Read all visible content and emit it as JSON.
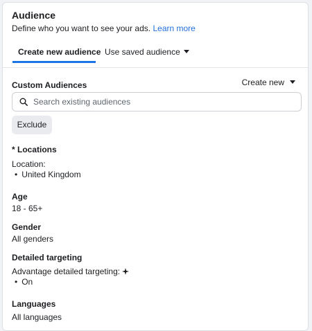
{
  "audience": {
    "title": "Audience",
    "subtitle": "Define who you want to see your ads.",
    "learn_more": "Learn more"
  },
  "tabs": [
    {
      "label": "Create new audience",
      "active": true
    },
    {
      "label": "Use saved audience",
      "active": false
    }
  ],
  "custom_audiences": {
    "label": "Custom Audiences",
    "create_new": "Create new",
    "search_placeholder": "Search existing audiences",
    "exclude_label": "Exclude"
  },
  "locations": {
    "label": "* Locations",
    "sublabel": "Location:",
    "items": [
      "United Kingdom"
    ]
  },
  "age": {
    "label": "Age",
    "value": "18 - 65+"
  },
  "gender": {
    "label": "Gender",
    "value": "All genders"
  },
  "detailed_targeting": {
    "label": "Detailed targeting",
    "advantage_label": "Advantage detailed targeting:",
    "advantage_value": "On"
  },
  "languages": {
    "label": "Languages",
    "value": "All languages"
  },
  "icons": {
    "search": "search-icon",
    "caret": "caret-down-icon",
    "sparkle": "sparkle-icon"
  },
  "colors": {
    "link": "#216fdb",
    "tab_underline": "#1b74e4"
  }
}
